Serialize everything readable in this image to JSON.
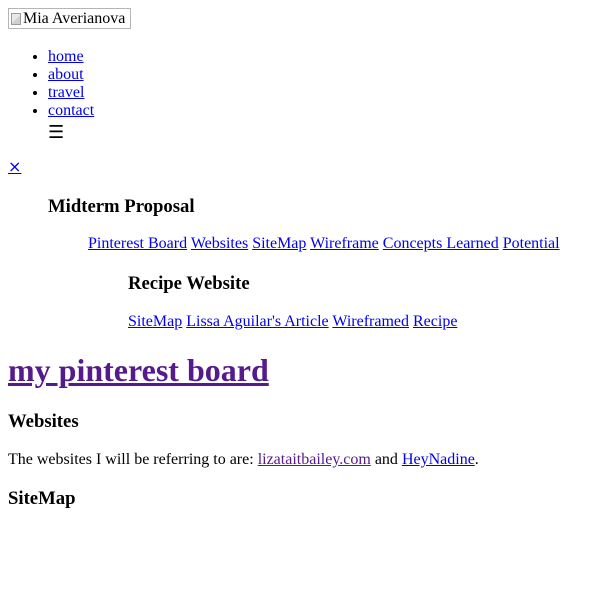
{
  "header": {
    "logo_alt": "Mia Averianova"
  },
  "nav": {
    "items": [
      {
        "label": "home"
      },
      {
        "label": "about"
      },
      {
        "label": "travel"
      },
      {
        "label": "contact"
      }
    ],
    "menu_glyph": "☰",
    "close_glyph": "×"
  },
  "midterm": {
    "heading": "Midterm Proposal",
    "links": [
      "Pinterest Board",
      "Websites",
      "SiteMap",
      "Wireframe",
      "Concepts Learned",
      "Potential"
    ]
  },
  "recipe": {
    "heading": "Recipe Website",
    "links": [
      "SiteMap",
      "Lissa Aguilar's Article",
      "Wireframed",
      "Recipe"
    ]
  },
  "main": {
    "title": "my pinterest board",
    "websites_heading": "Websites",
    "websites_text_before": "The websites I will be referring to are: ",
    "link_1": "lizataitbailey.com",
    "websites_text_between": " and ",
    "link_2": "HeyNadine",
    "websites_text_after": ".",
    "sitemap_heading": "SiteMap"
  },
  "colors": {
    "link": "#0000ee",
    "visited_link": "#551a8b"
  }
}
